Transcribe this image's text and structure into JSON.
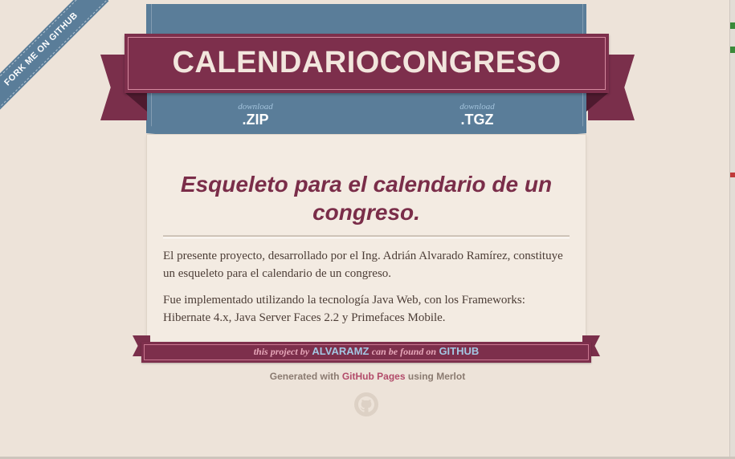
{
  "fork": {
    "label": "Fork me on GitHub"
  },
  "header": {
    "title": "CALENDARIOCONGRESO"
  },
  "downloads": [
    {
      "prefix": "download",
      "label": ".ZIP"
    },
    {
      "prefix": "download",
      "label": ".TGZ"
    }
  ],
  "content": {
    "headline": "Esqueleto para el calendario de un congreso.",
    "paragraphs": [
      "El presente proyecto, desarrollado por el Ing. Adrián Alvarado Ramírez, constituye un esqueleto para el calendario de un congreso.",
      "Fue implementado utilizando la tecnología Java Web, con los Frameworks: Hibernate 4.x, Java Server Faces 2.2 y Primefaces Mobile."
    ]
  },
  "footer": {
    "text_1": "this project by",
    "author": "ALVARAMZ",
    "text_2": "can be found on",
    "host": "GITHUB"
  },
  "generated": {
    "prefix": "Generated with",
    "link": "GitHub Pages",
    "suffix": "using Merlot"
  },
  "icons": {
    "footer_icon": "github-octocat-icon"
  },
  "colors": {
    "maroon": "#7d2f4c",
    "blue": "#5a7d99",
    "background": "#ede3d9"
  }
}
